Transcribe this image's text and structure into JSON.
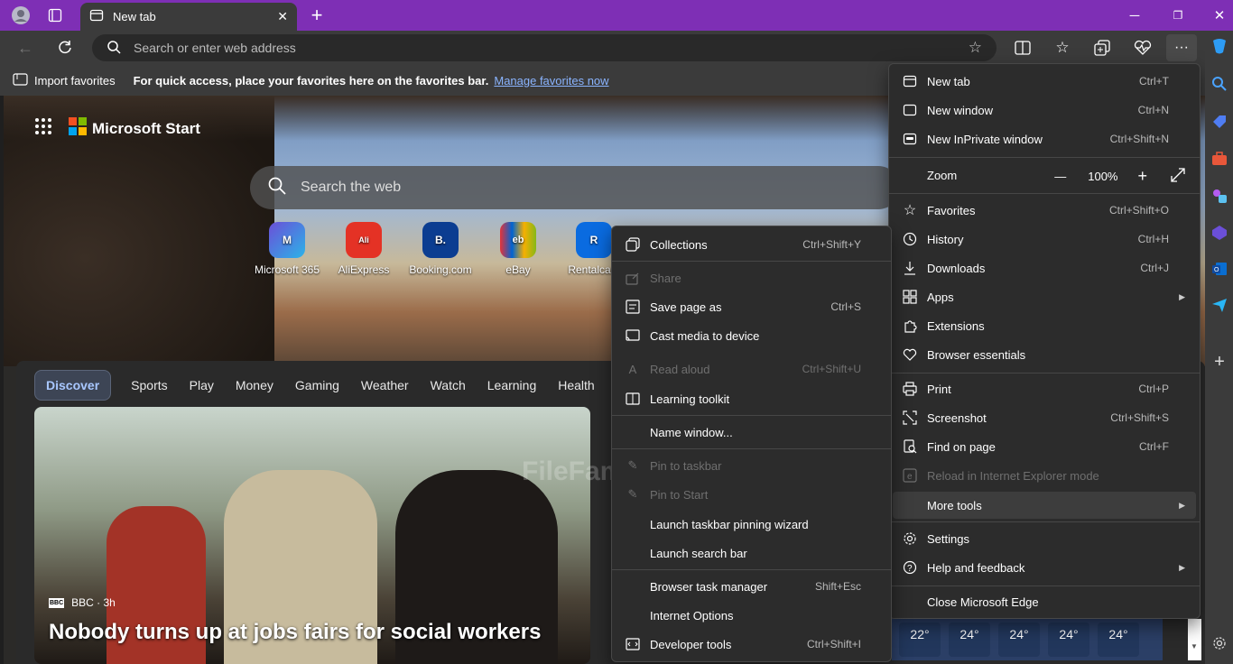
{
  "colors": {
    "titlebar": "#7e2fb5",
    "toolbar": "#3b3b3b",
    "menu_bg": "#2c2c2c",
    "accent": "#a8c7ff"
  },
  "browser": {
    "tab_title": "New tab",
    "address_placeholder": "Search or enter web address"
  },
  "favorites_bar": {
    "import_label": "Import favorites",
    "message": "For quick access, place your favorites here on the favorites bar.",
    "manage_link": "Manage favorites now"
  },
  "page": {
    "brand": "Microsoft Start",
    "search_placeholder": "Search the web",
    "quick_links": [
      {
        "label": "Microsoft 365",
        "icon": "M"
      },
      {
        "label": "AliExpress",
        "icon": "Ali"
      },
      {
        "label": "Booking.com",
        "icon": "B."
      },
      {
        "label": "eBay",
        "icon": "eb"
      },
      {
        "label": "Rentalcars",
        "icon": "R"
      }
    ],
    "feed_tabs": [
      "Discover",
      "Sports",
      "Play",
      "Money",
      "Gaming",
      "Weather",
      "Watch",
      "Learning",
      "Health"
    ],
    "news": {
      "source": "BBC · 3h",
      "source_logo": "BBC",
      "headline": "Nobody turns up at jobs fairs for social workers"
    },
    "weather_temps": [
      "22°",
      "24°",
      "24°",
      "24°",
      "24°"
    ],
    "watermark": "FileFamous"
  },
  "main_menu": {
    "new_tab": {
      "label": "New tab",
      "shortcut": "Ctrl+T"
    },
    "new_window": {
      "label": "New window",
      "shortcut": "Ctrl+N"
    },
    "new_inprivate": {
      "label": "New InPrivate window",
      "shortcut": "Ctrl+Shift+N"
    },
    "zoom": {
      "label": "Zoom",
      "minus": "—",
      "value": "100%",
      "plus": "+"
    },
    "favorites": {
      "label": "Favorites",
      "shortcut": "Ctrl+Shift+O"
    },
    "history": {
      "label": "History",
      "shortcut": "Ctrl+H"
    },
    "downloads": {
      "label": "Downloads",
      "shortcut": "Ctrl+J"
    },
    "apps": {
      "label": "Apps"
    },
    "extensions": {
      "label": "Extensions"
    },
    "browser_essentials": {
      "label": "Browser essentials"
    },
    "print": {
      "label": "Print",
      "shortcut": "Ctrl+P"
    },
    "screenshot": {
      "label": "Screenshot",
      "shortcut": "Ctrl+Shift+S"
    },
    "find_on_page": {
      "label": "Find on page",
      "shortcut": "Ctrl+F"
    },
    "reload_ie": {
      "label": "Reload in Internet Explorer mode"
    },
    "more_tools": {
      "label": "More tools"
    },
    "settings": {
      "label": "Settings"
    },
    "help": {
      "label": "Help and feedback"
    },
    "close": {
      "label": "Close Microsoft Edge"
    }
  },
  "more_tools_menu": {
    "collections": {
      "label": "Collections",
      "shortcut": "Ctrl+Shift+Y"
    },
    "share": {
      "label": "Share"
    },
    "save_page": {
      "label": "Save page as",
      "shortcut": "Ctrl+S"
    },
    "cast": {
      "label": "Cast media to device"
    },
    "read_aloud": {
      "label": "Read aloud",
      "shortcut": "Ctrl+Shift+U"
    },
    "learning_toolkit": {
      "label": "Learning toolkit"
    },
    "name_window": {
      "label": "Name window..."
    },
    "pin_taskbar": {
      "label": "Pin to taskbar"
    },
    "pin_start": {
      "label": "Pin to Start"
    },
    "pinning_wizard": {
      "label": "Launch taskbar pinning wizard"
    },
    "search_bar": {
      "label": "Launch search bar"
    },
    "task_manager": {
      "label": "Browser task manager",
      "shortcut": "Shift+Esc"
    },
    "internet_options": {
      "label": "Internet Options"
    },
    "dev_tools": {
      "label": "Developer tools",
      "shortcut": "Ctrl+Shift+I"
    }
  }
}
